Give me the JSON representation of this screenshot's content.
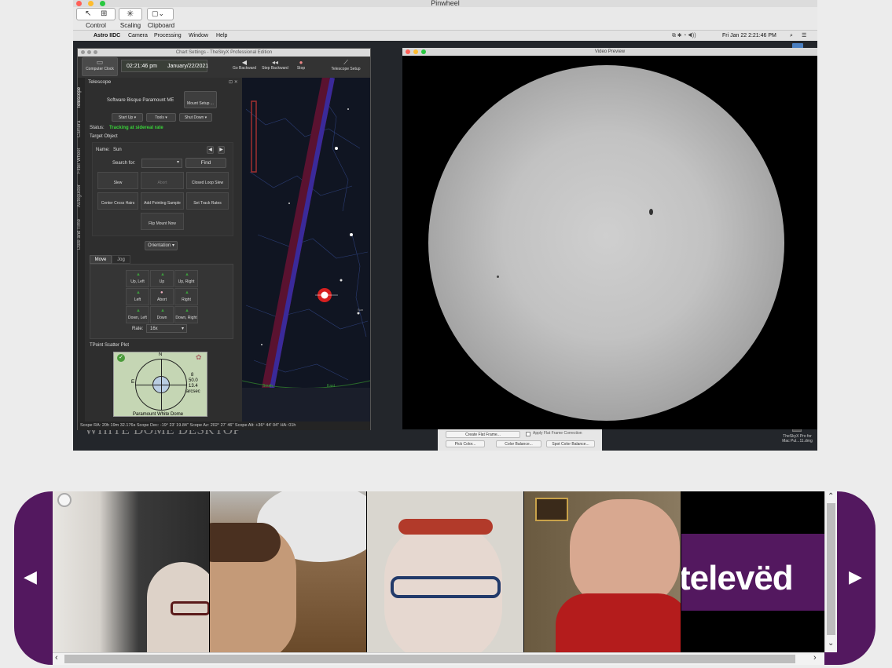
{
  "window": {
    "title": "Pinwheel"
  },
  "remote_toolbar": {
    "control": "Control",
    "scaling": "Scaling",
    "clipboard": "Clipboard"
  },
  "menubar": {
    "app": "Astro IIDC",
    "items": [
      "Camera",
      "Processing",
      "Window",
      "Help"
    ],
    "clock": "Fri Jan 22  2:21:46 PM"
  },
  "desktop": {
    "brand": "WHITE DOME DESKTOP",
    "file_label_1": "TheSkyX Pro for",
    "file_label_2": "Mac Pul...11.dmg"
  },
  "theskyx": {
    "title": "Chart Settings - TheSkyX Professional Edition",
    "toolbar": {
      "computer_clock": "Computer Clock",
      "time": "02:21:46 pm",
      "date": "January/22/2021",
      "go_backward": "Go Backward",
      "step_backward": "Step Backward",
      "stop": "Stop",
      "telescope_setup": "Telescope Setup"
    },
    "side_tabs": [
      "Telescope",
      "Camera",
      "Filter Wheel",
      "Autoguider",
      "Date and Time"
    ],
    "panel_title": "Telescope",
    "mount": "Software Bisque Paramount ME",
    "mount_setup": "Mount Setup ...",
    "start_up": "Start Up",
    "tools": "Tools",
    "shut_down": "Shut Down",
    "status_label": "Status:",
    "status": "Tracking at sidereal rate",
    "status_color": "#39d139",
    "target_object": "Target Object",
    "name_label": "Name:",
    "name": "Sun",
    "search_for": "Search for:",
    "find": "Find",
    "actions": [
      "Slew",
      "Abort",
      "Closed Loop Slew",
      "Center Cross Hairs",
      "Add Pointing Sample",
      "Set Track Rates",
      "Flip Mount Now"
    ],
    "orientation": "Orientation",
    "tabs": [
      "Move",
      "Jog"
    ],
    "move": [
      "Up, Left",
      "Up",
      "Up, Right",
      "Left",
      "Abort",
      "Right",
      "Down, Left",
      "Down",
      "Down, Right"
    ],
    "rate_label": "Rate:",
    "rate": "16x",
    "tpoint_title": "TPoint Scatter Plot",
    "tpoint": {
      "n": "N",
      "e": "E",
      "v1": "8",
      "v2": "50.0",
      "v3": "13.4",
      "unit": "arcsec",
      "caption": "Paramount White Dome"
    },
    "chart_labels": {
      "south": "South",
      "east": "East",
      "tag": "Sun"
    },
    "status_bar": "Scope RA: 20h 19m 32.176s    Scope Dec: -19° 23' 19.84\"    Scope Az: 202° 27' 46\"    Scope Alt: +36° 44' 04\"    HA: 01h"
  },
  "video": {
    "title": "Video Preview"
  },
  "under_panel": {
    "create_flat": "Create Flat Frame...",
    "apply_flat": "Apply Flat Frame Correction",
    "pick_color": "Pick Color...",
    "color_balance": "Color Balance...",
    "spot_color": "Spot Color Balance..."
  },
  "conference": {
    "logo_text": "televëd",
    "rail_color": "#53185f"
  }
}
